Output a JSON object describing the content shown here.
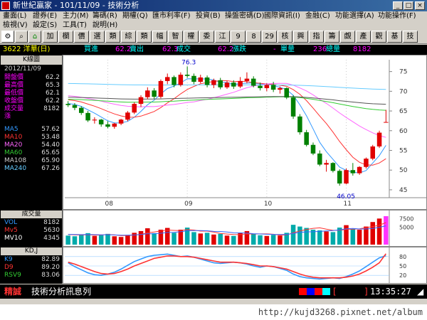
{
  "window": {
    "title": "新世紀贏家 - 101/11/09 - 技術分析"
  },
  "menu": {
    "row1": [
      "畫面(L)",
      "證券(E)",
      "主力(M)",
      "籌碼(R)",
      "期權(Q)",
      "匯市利率(F)",
      "投資(B)",
      "操盤密碼(D)",
      "國際資訊(I)",
      "金融(C)",
      "功能選擇(A)",
      "功能操作(F)"
    ],
    "row2": [
      "檢視(V)",
      "設定(S)",
      "工具(T)",
      "說明(H)"
    ]
  },
  "toolbar": [
    "加",
    "欄",
    "價",
    "選",
    "類",
    "綜",
    "類",
    "幅",
    "智",
    "權",
    "委",
    "江",
    "9",
    "8",
    "29",
    "核",
    "興",
    "指",
    "籌",
    "覷",
    "產",
    "觀",
    "基",
    "技"
  ],
  "quote": {
    "stock": "3622 洋華(日)",
    "buy_label": "買進",
    "buy": "62.2",
    "sell_label": "賣出",
    "sell": "62.3",
    "deal_label": "成交",
    "deal": "62.2",
    "change_label": "漲跌",
    "change": "-",
    "vol_label": "單量",
    "vol": "236",
    "total_label": "總量",
    "total": "8182"
  },
  "kline": {
    "title": "K線圖",
    "date": "2012/11/09",
    "rows": [
      {
        "label": "開盤價",
        "value": "62.2",
        "color": "#ff00ff"
      },
      {
        "label": "最高價",
        "value": "65.3",
        "color": "#ff00ff"
      },
      {
        "label": "最低價",
        "value": "62.1",
        "color": "#ff00ff"
      },
      {
        "label": "收盤價",
        "value": "62.2",
        "color": "#ff00ff"
      },
      {
        "label": "成交量",
        "value": "8182",
        "color": "#ff00ff"
      },
      {
        "label": "漲",
        "value": "",
        "color": "#ff00ff"
      }
    ],
    "ma": [
      {
        "label": "MA5",
        "value": "57.62",
        "color": "#3399ff"
      },
      {
        "label": "MA10",
        "value": "53.48",
        "color": "#ff3333"
      },
      {
        "label": "MA20",
        "value": "54.40",
        "color": "#ff66ff"
      },
      {
        "label": "MA60",
        "value": "65.65",
        "color": "#33cc33"
      },
      {
        "label": "MA108",
        "value": "65.90",
        "color": "#cccccc"
      },
      {
        "label": "MA240",
        "value": "67.26",
        "color": "#66ccff"
      }
    ]
  },
  "volume": {
    "title": "成交量",
    "rows": [
      {
        "label": "VOL",
        "value": "8182",
        "color": "#3399ff"
      },
      {
        "label": "Mv5",
        "value": "5630",
        "color": "#ff3333"
      },
      {
        "label": "MV10",
        "value": "4345",
        "color": "#ffffff"
      }
    ]
  },
  "kd": {
    "title": "KD,J",
    "rows": [
      {
        "label": "K9",
        "value": "82.89",
        "color": "#3399ff"
      },
      {
        "label": "D9",
        "value": "89.20",
        "color": "#ff3333"
      },
      {
        "label": "RSV9",
        "value": "83.06",
        "color": "#33cc33"
      }
    ]
  },
  "status": {
    "tag": "精誠",
    "message": "技術分析訊息列",
    "bracket_open": "[",
    "bracket_close": "]",
    "time": "13:35:27"
  },
  "footer": "http://kujd3268.pixnet.net/album",
  "chart_data": [
    {
      "type": "candlestick",
      "title": "K線圖",
      "x_labels": [
        "08",
        "09",
        "10",
        "11"
      ],
      "y_ticks": [
        45,
        50,
        55,
        60,
        65,
        70,
        75
      ],
      "ylim": [
        43,
        78
      ],
      "annotations": [
        {
          "text": "76.3"
        },
        {
          "text": "46.05"
        }
      ],
      "candles": [
        [
          66.8,
          67.5,
          66.0,
          66.5
        ],
        [
          66.5,
          67.0,
          65.2,
          65.8
        ],
        [
          65.8,
          66.2,
          64.0,
          64.5
        ],
        [
          64.5,
          65.0,
          62.2,
          62.6
        ],
        [
          62.6,
          63.4,
          61.8,
          62.8
        ],
        [
          62.8,
          63.0,
          61.0,
          61.6
        ],
        [
          61.6,
          62.4,
          60.6,
          61.0
        ],
        [
          61.0,
          62.0,
          60.5,
          61.8
        ],
        [
          61.8,
          63.0,
          61.4,
          62.8
        ],
        [
          62.8,
          65.0,
          62.4,
          64.6
        ],
        [
          64.6,
          67.2,
          64.2,
          66.8
        ],
        [
          66.8,
          69.0,
          66.0,
          68.5
        ],
        [
          68.5,
          71.0,
          68.0,
          70.2
        ],
        [
          70.2,
          70.8,
          68.0,
          68.6
        ],
        [
          68.6,
          73.0,
          68.2,
          72.6
        ],
        [
          72.6,
          74.5,
          71.8,
          73.6
        ],
        [
          73.6,
          74.0,
          71.0,
          71.6
        ],
        [
          71.6,
          74.8,
          71.2,
          74.2
        ],
        [
          74.2,
          76.3,
          73.4,
          73.9
        ],
        [
          73.9,
          74.5,
          71.8,
          72.4
        ],
        [
          72.4,
          74.2,
          72.0,
          73.5
        ],
        [
          73.5,
          74.0,
          71.0,
          71.6
        ],
        [
          71.6,
          73.2,
          70.8,
          72.8
        ],
        [
          72.8,
          73.4,
          70.5,
          71.0
        ],
        [
          71.0,
          72.6,
          70.6,
          72.2
        ],
        [
          72.2,
          72.8,
          70.6,
          71.2
        ],
        [
          71.2,
          73.6,
          70.8,
          72.6
        ],
        [
          72.6,
          74.8,
          72.0,
          73.2
        ],
        [
          73.2,
          73.8,
          71.0,
          71.4
        ],
        [
          71.4,
          72.2,
          70.2,
          70.8
        ],
        [
          70.8,
          72.0,
          70.0,
          71.6
        ],
        [
          71.6,
          72.4,
          69.8,
          70.4
        ],
        [
          70.4,
          71.2,
          69.4,
          70.8
        ],
        [
          70.8,
          71.0,
          68.0,
          68.4
        ],
        [
          68.4,
          69.0,
          63.0,
          63.6
        ],
        [
          63.6,
          64.2,
          59.0,
          59.6
        ],
        [
          59.6,
          60.2,
          56.0,
          56.4
        ],
        [
          56.4,
          57.0,
          53.8,
          54.2
        ],
        [
          54.2,
          55.0,
          51.0,
          51.4
        ],
        [
          51.4,
          52.6,
          49.6,
          51.8
        ],
        [
          51.8,
          52.0,
          49.4,
          49.8
        ],
        [
          49.8,
          50.2,
          46.05,
          46.6
        ],
        [
          46.6,
          50.4,
          46.4,
          50.0
        ],
        [
          50.0,
          51.8,
          48.6,
          49.2
        ],
        [
          49.2,
          51.0,
          48.8,
          50.8
        ],
        [
          50.8,
          53.2,
          50.4,
          52.9
        ],
        [
          52.9,
          56.4,
          52.5,
          56.0
        ],
        [
          56.0,
          60.0,
          55.6,
          59.5
        ],
        [
          62.2,
          65.3,
          62.1,
          62.2
        ]
      ],
      "series": [
        {
          "name": "MA5",
          "color": "#3399ff"
        },
        {
          "name": "MA10",
          "color": "#ff3333"
        },
        {
          "name": "MA20",
          "color": "#ff66ff"
        },
        {
          "name": "MA60",
          "color": "#33cc33"
        },
        {
          "name": "MA108",
          "color": "#555555"
        },
        {
          "name": "MA240",
          "color": "#66ccff"
        }
      ]
    },
    {
      "type": "bar",
      "title": "成交量",
      "y_ticks": [
        5000,
        7500
      ],
      "ylim": [
        0,
        9000
      ],
      "values": [
        2600,
        2400,
        2900,
        3300,
        2500,
        2700,
        3100,
        2400,
        2200,
        2800,
        3400,
        3900,
        4700,
        3300,
        4300,
        4800,
        3400,
        4300,
        4900,
        3600,
        3200,
        3400,
        2900,
        3100,
        2600,
        2500,
        3300,
        3900,
        3000,
        2700,
        2500,
        2800,
        2600,
        3400,
        5700,
        5200,
        4800,
        4300,
        4100,
        3800,
        3600,
        4900,
        5600,
        4400,
        4300,
        5200,
        6500,
        7500,
        8182
      ]
    },
    {
      "type": "line",
      "title": "KD,J",
      "y_ticks": [
        20,
        50,
        80
      ],
      "ylim": [
        0,
        100
      ],
      "series": [
        {
          "name": "K9",
          "color": "#3399ff",
          "values": [
            60,
            48,
            38,
            28,
            22,
            20,
            24,
            30,
            40,
            52,
            64,
            72,
            80,
            84,
            86,
            88,
            84,
            80,
            82,
            78,
            72,
            66,
            60,
            58,
            60,
            62,
            60,
            56,
            50,
            46,
            50,
            48,
            42,
            36,
            24,
            16,
            12,
            10,
            8,
            10,
            12,
            10,
            16,
            24,
            34,
            48,
            62,
            76,
            82.89
          ]
        },
        {
          "name": "D9",
          "color": "#ff3333",
          "values": [
            62,
            56,
            48,
            40,
            32,
            26,
            24,
            26,
            32,
            40,
            50,
            58,
            66,
            74,
            78,
            82,
            82,
            80,
            80,
            78,
            74,
            70,
            66,
            62,
            62,
            62,
            60,
            58,
            54,
            50,
            50,
            48,
            44,
            40,
            32,
            24,
            18,
            14,
            12,
            12,
            12,
            12,
            14,
            18,
            24,
            34,
            46,
            60,
            89.2
          ]
        }
      ]
    }
  ]
}
